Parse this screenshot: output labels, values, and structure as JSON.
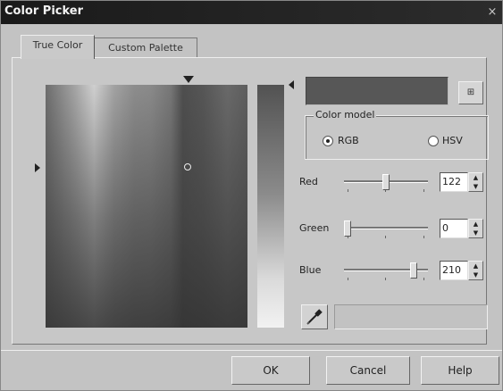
{
  "window": {
    "title": "Color Picker",
    "close_glyph": "×"
  },
  "tabs": [
    {
      "label": "True Color",
      "active": true
    },
    {
      "label": "Custom Palette",
      "active": false
    }
  ],
  "swatch": {
    "color": "#575757",
    "button_label": "⊞"
  },
  "color_model": {
    "legend": "Color model",
    "options": [
      {
        "label": "RGB",
        "checked": true
      },
      {
        "label": "HSV",
        "checked": false
      }
    ]
  },
  "channels": [
    {
      "label": "Red",
      "value": "122",
      "max": 255
    },
    {
      "label": "Green",
      "value": "0",
      "max": 255
    },
    {
      "label": "Blue",
      "value": "210",
      "max": 255
    }
  ],
  "spin": {
    "up": "▲",
    "down": "▼"
  },
  "buttons": {
    "ok": "OK",
    "cancel": "Cancel",
    "help": "Help"
  }
}
